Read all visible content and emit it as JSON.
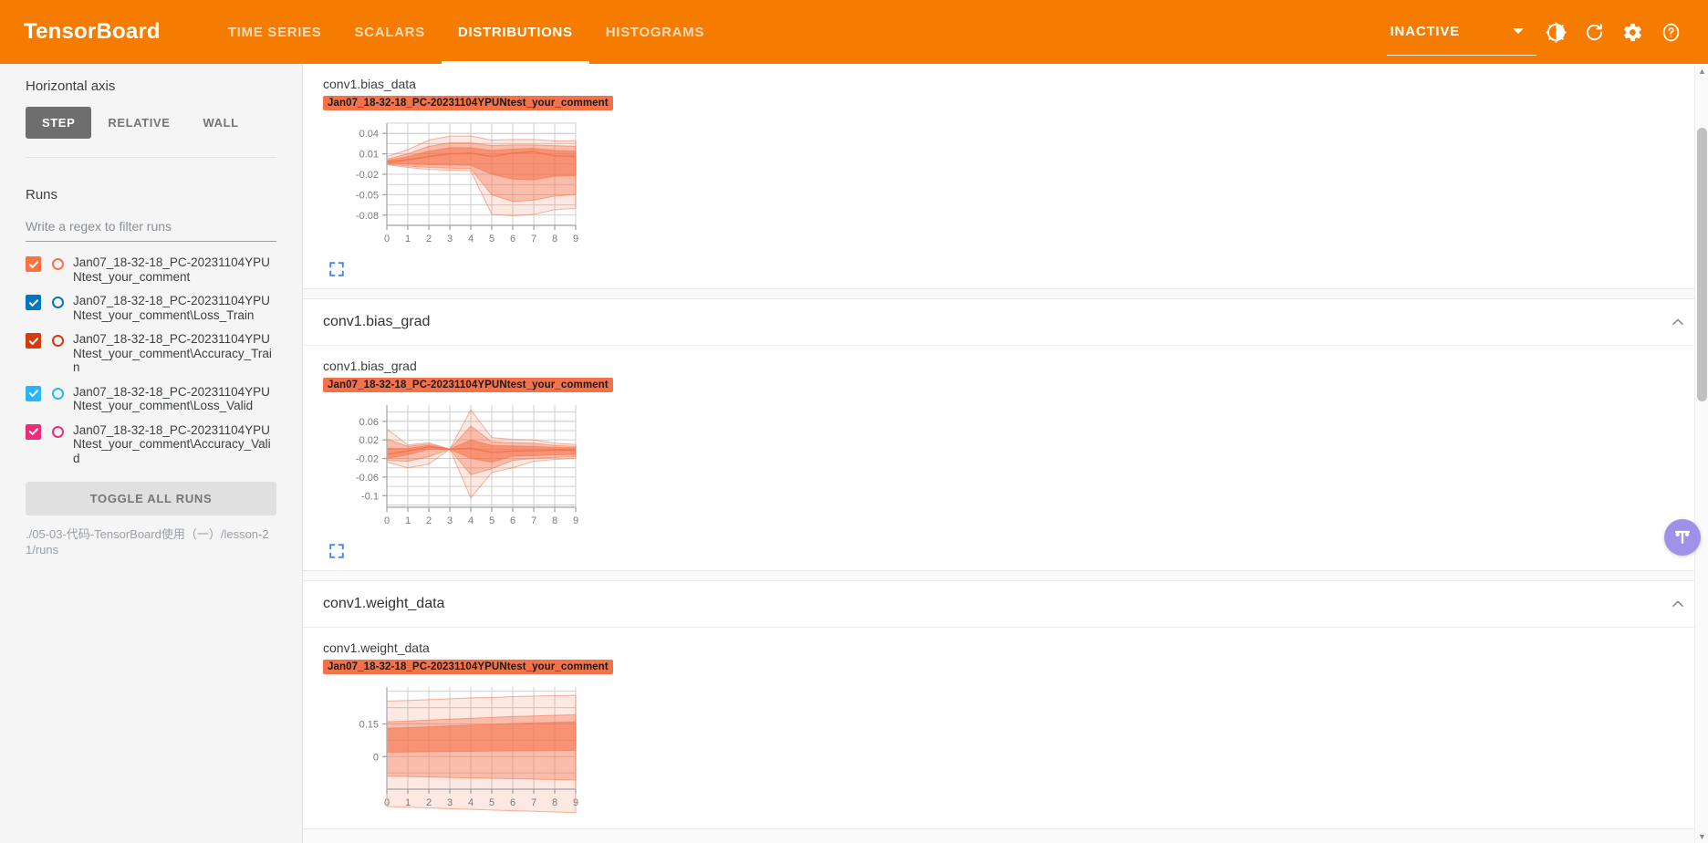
{
  "app": {
    "brand": "TensorBoard",
    "tabs": [
      {
        "label": "TIME SERIES",
        "active": false
      },
      {
        "label": "SCALARS",
        "active": false
      },
      {
        "label": "DISTRIBUTIONS",
        "active": true
      },
      {
        "label": "HISTOGRAMS",
        "active": false
      }
    ],
    "status": "INACTIVE",
    "icons": {
      "caret": "chevron-down-icon",
      "brightness": "brightness-contrast-icon",
      "refresh": "refresh-icon",
      "settings": "gear-icon",
      "help": "help-circle-icon"
    },
    "accent": "#f57c00"
  },
  "sidebar": {
    "horizontal_axis_label": "Horizontal axis",
    "axis_options": [
      {
        "label": "STEP",
        "active": true
      },
      {
        "label": "RELATIVE",
        "active": false
      },
      {
        "label": "WALL",
        "active": false
      }
    ],
    "runs_label": "Runs",
    "filter_placeholder": "Write a regex to filter runs",
    "filter_value": "",
    "runs": [
      {
        "name": "Jan07_18-32-18_PC-20231104YPUNtest_your_comment",
        "color": "#ff7043",
        "checked": true
      },
      {
        "name": "Jan07_18-32-18_PC-20231104YPUNtest_your_comment\\Loss_Train",
        "color": "#0277bd",
        "checked": true
      },
      {
        "name": "Jan07_18-32-18_PC-20231104YPUNtest_your_comment\\Accuracy_Train",
        "color": "#d63b10",
        "checked": true
      },
      {
        "name": "Jan07_18-32-18_PC-20231104YPUNtest_your_comment\\Loss_Valid",
        "color": "#29b6f6",
        "checked": true
      },
      {
        "name": "Jan07_18-32-18_PC-20231104YPUNtest_your_comment\\Accuracy_Valid",
        "color": "#ec2e7a",
        "checked": true
      }
    ],
    "toggle_all_label": "TOGGLE ALL RUNS",
    "logdir": "./05-03-代码-TensorBoard使用（一）/lesson-21/runs"
  },
  "chart_data": [
    {
      "type": "area",
      "title": "conv1.bias_data",
      "card_title": "conv1.bias_data",
      "run_badge": "Jan07_18-32-18_PC-20231104YPUNtest_your_comment",
      "xlabel": "",
      "ylabel": "",
      "x": [
        0,
        1,
        2,
        3,
        4,
        5,
        6,
        7,
        8,
        9
      ],
      "xtick_labels": [
        "0",
        "1",
        "2",
        "3",
        "4",
        "5",
        "6",
        "7",
        "8",
        "9"
      ],
      "ytick_labels": [
        "0.04",
        "0.01",
        "-0.02",
        "-0.05",
        "-0.08"
      ],
      "ytick_values": [
        0.04,
        0.01,
        -0.02,
        -0.05,
        -0.08
      ],
      "ylim": [
        -0.095,
        0.055
      ],
      "xlim": [
        0,
        9
      ],
      "grid": true,
      "legend": "none",
      "series": [
        {
          "name": "max",
          "values": [
            0.006,
            0.016,
            0.03,
            0.036,
            0.036,
            0.03,
            0.031,
            0.031,
            0.029,
            0.029
          ]
        },
        {
          "name": "q93",
          "values": [
            0.002,
            0.01,
            0.021,
            0.026,
            0.026,
            0.022,
            0.023,
            0.023,
            0.022,
            0.021
          ]
        },
        {
          "name": "q84",
          "values": [
            0.0,
            0.006,
            0.014,
            0.019,
            0.019,
            0.015,
            0.017,
            0.018,
            0.015,
            0.014
          ]
        },
        {
          "name": "median",
          "values": [
            -0.002,
            0.001,
            0.006,
            0.01,
            0.011,
            0.006,
            0.011,
            0.013,
            0.007,
            0.006
          ]
        },
        {
          "name": "q16",
          "values": [
            -0.004,
            -0.005,
            -0.006,
            -0.006,
            -0.007,
            -0.02,
            -0.027,
            -0.028,
            -0.023,
            -0.022
          ]
        },
        {
          "name": "q7",
          "values": [
            -0.005,
            -0.008,
            -0.01,
            -0.011,
            -0.012,
            -0.05,
            -0.06,
            -0.058,
            -0.052,
            -0.05
          ]
        },
        {
          "name": "min",
          "values": [
            -0.006,
            -0.01,
            -0.013,
            -0.014,
            -0.015,
            -0.079,
            -0.081,
            -0.079,
            -0.072,
            -0.07
          ]
        }
      ]
    },
    {
      "type": "area",
      "title": "conv1.bias_grad",
      "card_title": "conv1.bias_grad",
      "run_badge": "Jan07_18-32-18_PC-20231104YPUNtest_your_comment",
      "xlabel": "",
      "ylabel": "",
      "x": [
        0,
        1,
        2,
        3,
        4,
        5,
        6,
        7,
        8,
        9
      ],
      "xtick_labels": [
        "0",
        "1",
        "2",
        "3",
        "4",
        "5",
        "6",
        "7",
        "8",
        "9"
      ],
      "ytick_labels": [
        "0.06",
        "0.02",
        "-0.02",
        "-0.06",
        "-0.1"
      ],
      "ytick_values": [
        0.06,
        0.02,
        -0.02,
        -0.06,
        -0.1
      ],
      "ylim": [
        -0.125,
        0.095
      ],
      "xlim": [
        0,
        9
      ],
      "grid": true,
      "legend": "none",
      "series": [
        {
          "name": "max",
          "values": [
            0.044,
            0.009,
            0.014,
            0.0,
            0.085,
            0.025,
            0.021,
            0.02,
            0.013,
            0.01
          ]
        },
        {
          "name": "q93",
          "values": [
            0.022,
            0.006,
            0.011,
            0.0,
            0.05,
            0.016,
            0.014,
            0.013,
            0.008,
            0.006
          ]
        },
        {
          "name": "q84",
          "values": [
            0.002,
            0.002,
            0.008,
            0.0,
            0.02,
            0.008,
            0.007,
            0.006,
            0.004,
            0.003
          ]
        },
        {
          "name": "median",
          "values": [
            -0.011,
            -0.004,
            0.005,
            0.0,
            0.002,
            -0.007,
            -0.004,
            -0.003,
            -0.002,
            -0.002
          ]
        },
        {
          "name": "q16",
          "values": [
            -0.02,
            -0.012,
            0.0,
            0.0,
            -0.02,
            -0.028,
            -0.015,
            -0.014,
            -0.012,
            -0.011
          ]
        },
        {
          "name": "q7",
          "values": [
            -0.024,
            -0.026,
            -0.016,
            0.0,
            -0.055,
            -0.042,
            -0.024,
            -0.02,
            -0.018,
            -0.016
          ]
        },
        {
          "name": "min",
          "values": [
            -0.028,
            -0.04,
            -0.032,
            0.0,
            -0.105,
            -0.05,
            -0.04,
            -0.026,
            -0.022,
            -0.02
          ]
        }
      ]
    },
    {
      "type": "area",
      "title": "conv1.weight_data",
      "card_title": "conv1.weight_data",
      "run_badge": "Jan07_18-32-18_PC-20231104YPUNtest_your_comment",
      "xlabel": "",
      "ylabel": "",
      "x": [
        0,
        1,
        2,
        3,
        4,
        5,
        6,
        7,
        8,
        9
      ],
      "xtick_labels": [
        "0",
        "1",
        "2",
        "3",
        "4",
        "5",
        "6",
        "7",
        "8",
        "9"
      ],
      "ytick_labels": [
        "0.15",
        "0"
      ],
      "ytick_values": [
        0.15,
        0.0
      ],
      "ylim": [
        -0.15,
        0.32
      ],
      "xlim": [
        0,
        9
      ],
      "grid": true,
      "legend": "none",
      "series": [
        {
          "name": "max",
          "values": [
            0.255,
            0.258,
            0.262,
            0.266,
            0.27,
            0.272,
            0.276,
            0.278,
            0.28,
            0.282
          ]
        },
        {
          "name": "q93",
          "values": [
            0.16,
            0.163,
            0.168,
            0.172,
            0.176,
            0.18,
            0.184,
            0.187,
            0.19,
            0.192
          ]
        },
        {
          "name": "q84",
          "values": [
            0.13,
            0.133,
            0.137,
            0.141,
            0.145,
            0.148,
            0.152,
            0.155,
            0.158,
            0.16
          ]
        },
        {
          "name": "median",
          "values": [
            0.02,
            0.021,
            0.022,
            0.023,
            0.024,
            0.025,
            0.026,
            0.027,
            0.028,
            0.029
          ]
        },
        {
          "name": "q16",
          "values": [
            -0.09,
            -0.092,
            -0.094,
            -0.096,
            -0.098,
            -0.1,
            -0.102,
            -0.104,
            -0.106,
            -0.108
          ]
        },
        {
          "name": "min",
          "values": [
            -0.23,
            -0.233,
            -0.236,
            -0.24,
            -0.243,
            -0.246,
            -0.249,
            -0.252,
            -0.255,
            -0.258
          ]
        }
      ]
    }
  ],
  "colors": {
    "accent": "#f57c00",
    "chart_fill": "#f4724a",
    "expand_icon": "#4285f4",
    "fab": "#a091e8"
  },
  "icons": {
    "expand": "expand-fullscreen-icon",
    "collapse_chevron": "chevron-up-icon",
    "fab": "tune-icon"
  }
}
